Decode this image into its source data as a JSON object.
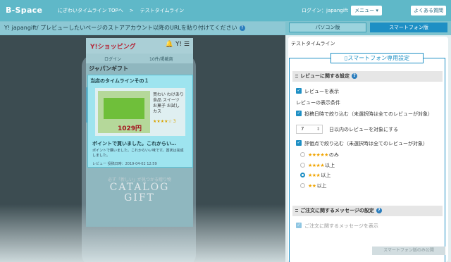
{
  "header": {
    "brand": "B-Space",
    "breadcrumb": [
      "にぎわいタイムライン TOPへ",
      "テストタイムライン"
    ],
    "breadcrumb_sep": ">",
    "login_text": "ログイン：japangift",
    "menu_label": "メニュー ▾",
    "faq_label": "よくある質問"
  },
  "urlbar": {
    "text": "Y! japangift/ プレビューしたいページのストアアカウント以降のURLを貼り付けてください"
  },
  "view_tabs": {
    "pc": "パソコン版",
    "smartphone": "スマートフォン版",
    "active": "smartphone"
  },
  "preview": {
    "shop_logo": "Y!ショッピング",
    "login_link": "ログイン",
    "later_link": "10件/掲載商",
    "shop_name": "ジャパンギフト",
    "timeline_title": "当店のタイムラインその１",
    "product_desc": "買わい わけあり食品 スイーツ お菓子 お試し カス",
    "product_rating": "★★★★☆ 3",
    "product_price": "1029円",
    "review_title": "ポイントで買いました。これからい…",
    "review_body": "ポイントで購いました。これからいい味です。賞状は完成しました。",
    "review_meta": "レビュー 投稿日時：2019-04-02 12:59",
    "catalog_small": "必ず「新しい」が見つかる贈り物",
    "catalog_big1": "CATALOG",
    "catalog_big2": "GIFT"
  },
  "settings": {
    "timeline_name": "テストタイムライン",
    "sp_setting_label": "スマートフォン専用設定",
    "review_section": {
      "title": "レビューに関する設定",
      "show_reviews_label": "レビューを表示",
      "show_reviews_checked": true,
      "conditions_label": "レビューの表示条件",
      "date_filter_label": "投稿日時で絞り込む（未選択時は全てのレビューが対象）",
      "date_filter_checked": true,
      "days_value": "7",
      "days_suffix": "日以内のレビューを対象にする",
      "rating_filter_label": "評価点で絞り込む（未選択時は全てのレビューが対象）",
      "rating_filter_checked": true,
      "rating_options": [
        {
          "stars": "★★★★★",
          "label": "のみ",
          "selected": false
        },
        {
          "stars": "★★★★",
          "label": "以上",
          "selected": false
        },
        {
          "stars": "★★★",
          "label": "以上",
          "selected": true
        },
        {
          "stars": "★★",
          "label": "以上",
          "selected": false
        }
      ]
    },
    "order_section": {
      "title": "ご注文に関するメッセージの設定",
      "show_message_label": "ご注文に関するメッセージを表示",
      "show_message_checked": true
    },
    "footer_button": "スマートフォン版のみ公開"
  },
  "colors": {
    "header": "#5fb8c8",
    "accent": "#1e8fc4",
    "star": "#f0a400"
  },
  "icons": {
    "help": "question-circle-icon",
    "phone": "smartphone-icon",
    "grip": "drag-handle-icon",
    "check": "checkmark-icon"
  }
}
